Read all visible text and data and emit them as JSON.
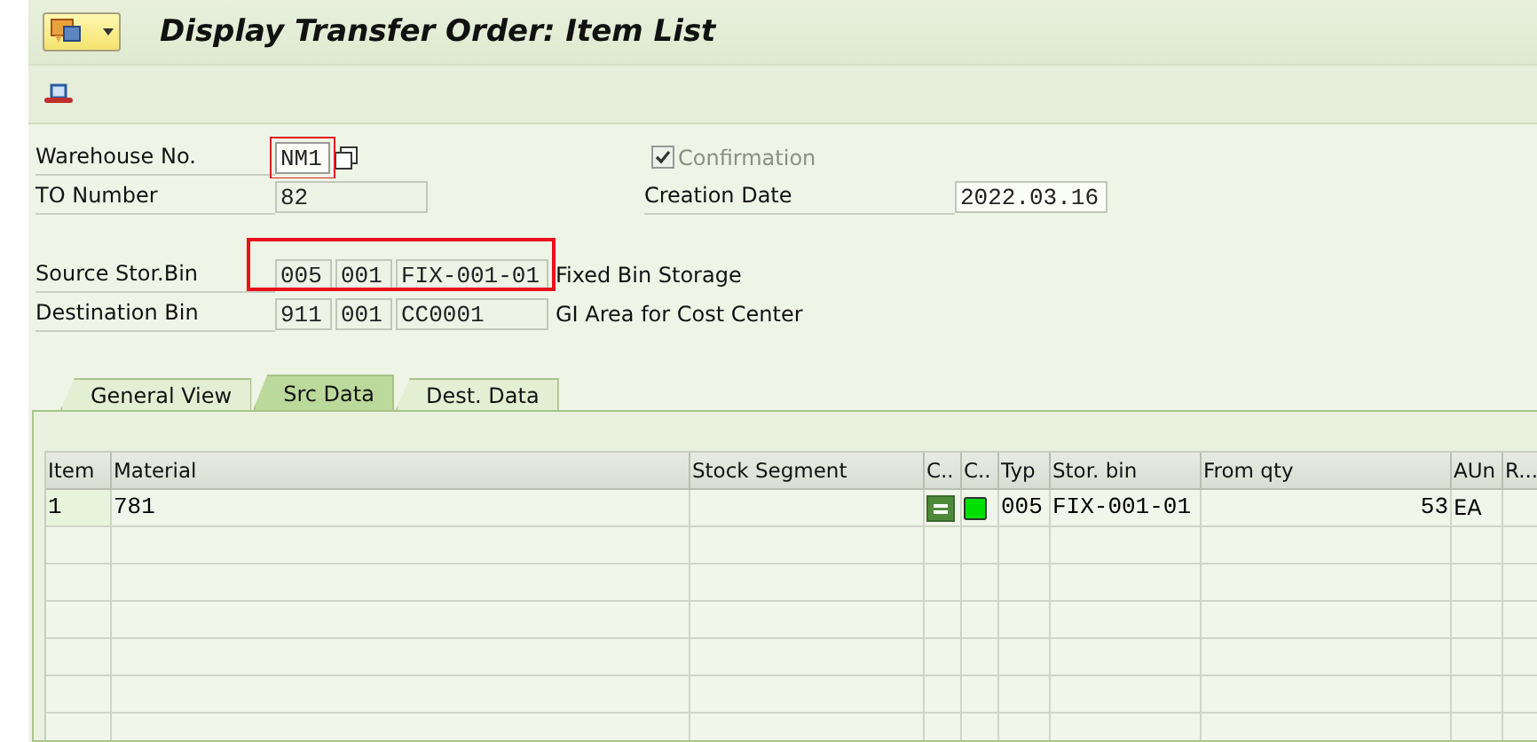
{
  "window": {
    "title": "Display Transfer Order: Item List"
  },
  "header": {
    "warehouse": {
      "label": "Warehouse No.",
      "value": "NM1",
      "focused": true
    },
    "to_number": {
      "label": "TO Number",
      "value": "82"
    },
    "confirmation": {
      "label": "Confirmation",
      "checked": true,
      "disabled": true
    },
    "creation_date": {
      "label": "Creation Date",
      "value": "2022.03.16"
    },
    "source_bin": {
      "label": "Source Stor.Bin",
      "type": "005",
      "section": "001",
      "bin": "FIX-001-01",
      "description": "Fixed Bin Storage",
      "highlighted": true
    },
    "destination_bin": {
      "label": "Destination Bin",
      "type": "911",
      "section": "001",
      "bin": "CC0001",
      "description": "GI Area for Cost Center",
      "highlighted": false
    }
  },
  "tabs": [
    {
      "label": "General View",
      "selected": false
    },
    {
      "label": "Src Data",
      "selected": true
    },
    {
      "label": "Dest. Data",
      "selected": false
    }
  ],
  "table": {
    "columns": [
      "Item",
      "Material",
      "Stock Segment",
      "C..",
      "C..",
      "Typ",
      "Stor. bin",
      "From qty",
      "AUn",
      "R..."
    ],
    "rows": [
      {
        "item": "1",
        "material": "781",
        "typ": "005",
        "stor_bin": "FIX-001-01",
        "from_qty": "53",
        "aun": "EA"
      }
    ]
  }
}
